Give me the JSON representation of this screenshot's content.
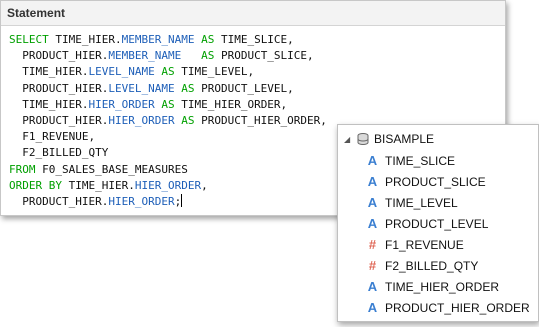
{
  "panel": {
    "title": "Statement"
  },
  "sql_lines": [
    [
      [
        "kw",
        "SELECT "
      ],
      [
        "",
        "TIME_HIER."
      ],
      [
        "id",
        "MEMBER_NAME"
      ],
      [
        "kw",
        " AS "
      ],
      [
        "",
        "TIME_SLICE,"
      ]
    ],
    [
      [
        "",
        "  PRODUCT_HIER."
      ],
      [
        "id",
        "MEMBER_NAME"
      ],
      [
        "kw",
        "   AS "
      ],
      [
        "",
        "PRODUCT_SLICE,"
      ]
    ],
    [
      [
        "",
        "  TIME_HIER."
      ],
      [
        "id",
        "LEVEL_NAME"
      ],
      [
        "kw",
        " AS "
      ],
      [
        "",
        "TIME_LEVEL,"
      ]
    ],
    [
      [
        "",
        "  PRODUCT_HIER."
      ],
      [
        "id",
        "LEVEL_NAME"
      ],
      [
        "kw",
        " AS "
      ],
      [
        "",
        "PRODUCT_LEVEL,"
      ]
    ],
    [
      [
        "",
        "  TIME_HIER."
      ],
      [
        "id",
        "HIER_ORDER"
      ],
      [
        "kw",
        " AS "
      ],
      [
        "",
        "TIME_HIER_ORDER,"
      ]
    ],
    [
      [
        "",
        "  PRODUCT_HIER."
      ],
      [
        "id",
        "HIER_ORDER"
      ],
      [
        "kw",
        " AS "
      ],
      [
        "",
        "PRODUCT_HIER_ORDER,"
      ]
    ],
    [
      [
        "",
        "  F1_REVENUE,"
      ]
    ],
    [
      [
        "",
        "  F2_BILLED_QTY"
      ]
    ],
    [
      [
        "kw",
        "FROM "
      ],
      [
        "",
        "F0_SALES_BASE_MEASURES"
      ]
    ],
    [
      [
        "kw",
        "ORDER BY "
      ],
      [
        "",
        "TIME_HIER."
      ],
      [
        "id",
        "HIER_ORDER"
      ],
      [
        "",
        ","
      ]
    ],
    [
      [
        "",
        "  PRODUCT_HIER."
      ],
      [
        "id",
        "HIER_ORDER"
      ],
      [
        "",
        ";"
      ]
    ]
  ],
  "popup": {
    "root_label": "BISAMPLE",
    "expander_icon": "collapse-triangle-icon",
    "root_icon": "database-icon",
    "items": [
      {
        "label": "TIME_SLICE",
        "kind": "attribute"
      },
      {
        "label": "PRODUCT_SLICE",
        "kind": "attribute"
      },
      {
        "label": "TIME_LEVEL",
        "kind": "attribute"
      },
      {
        "label": "PRODUCT_LEVEL",
        "kind": "attribute"
      },
      {
        "label": "F1_REVENUE",
        "kind": "measure"
      },
      {
        "label": "F2_BILLED_QTY",
        "kind": "measure"
      },
      {
        "label": "TIME_HIER_ORDER",
        "kind": "attribute"
      },
      {
        "label": "PRODUCT_HIER_ORDER",
        "kind": "attribute"
      }
    ]
  },
  "colors": {
    "keyword": "#00a000",
    "identifier": "#1e5fb8",
    "attribute_icon": "#3b7fd1",
    "measure_icon": "#e06a5a"
  }
}
